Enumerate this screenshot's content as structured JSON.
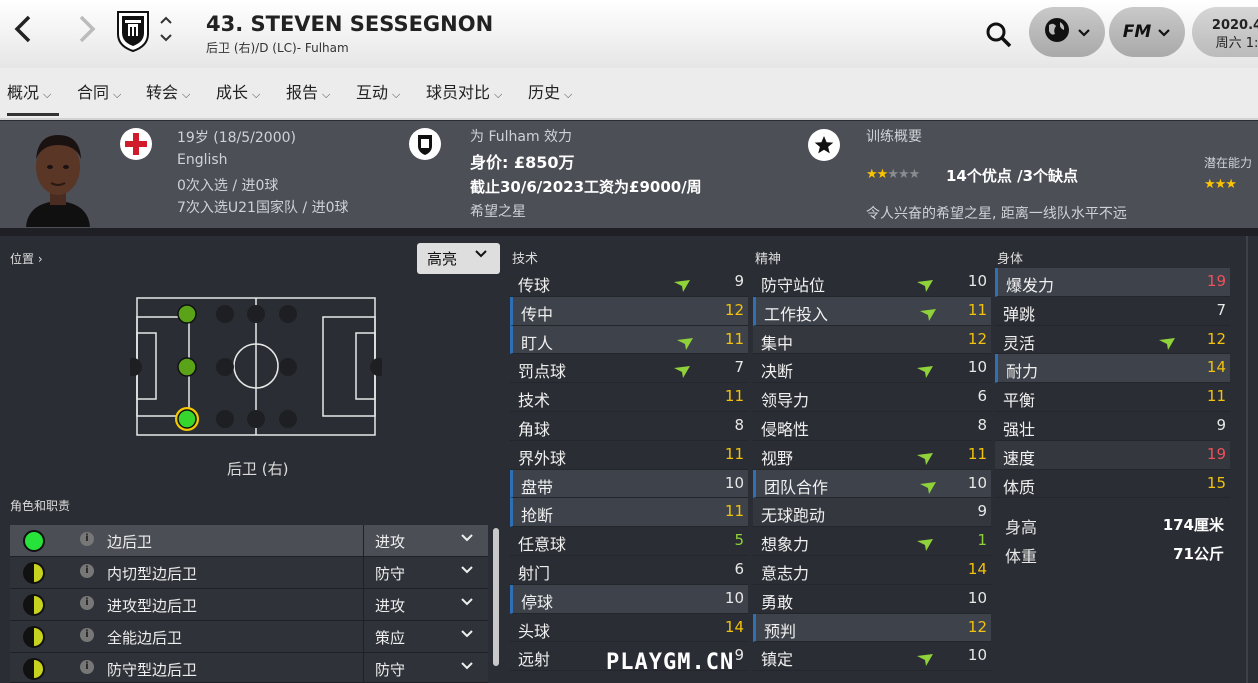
{
  "header": {
    "player_name": "43. STEVEN SESSEGNON",
    "player_sub": "后卫 (右)/D (LC)- Fulham",
    "date_line1": "2020.4",
    "date_line2": "周六 1:"
  },
  "tabs": [
    {
      "label": "概况"
    },
    {
      "label": "合同"
    },
    {
      "label": "转会"
    },
    {
      "label": "成长"
    },
    {
      "label": "报告"
    },
    {
      "label": "互动"
    },
    {
      "label": "球员对比"
    },
    {
      "label": "历史"
    }
  ],
  "info": {
    "age": "19岁 (18/5/2000)",
    "nationality": "English",
    "caps": "0次入选 / 进0球",
    "u21_caps": "7次入选U21国家队 / 进0球",
    "club_line": "为 Fulham 效力",
    "value": "身价: £850万",
    "contract": "截止30/6/2023工资为£9000/周",
    "status": "希望之星",
    "training_title": "训练概要",
    "traits": "14个优点 /3个缺点",
    "potential_label": "潜在能力",
    "scout_comment": "令人兴奋的希望之星, 距离一线队水平不远",
    "current_stars": 2,
    "potential_stars": 3
  },
  "position": {
    "label": "位置",
    "highlight_select": "高亮",
    "caption": "后卫 (右)"
  },
  "roles_label": "角色和职责",
  "roles": [
    {
      "name": "边后卫",
      "duty": "进攻",
      "rating": "full"
    },
    {
      "name": "内切型边后卫",
      "duty": "防守",
      "rating": "half"
    },
    {
      "name": "进攻型边后卫",
      "duty": "进攻",
      "rating": "half"
    },
    {
      "name": "全能边后卫",
      "duty": "策应",
      "rating": "half"
    },
    {
      "name": "防守型边后卫",
      "duty": "防守",
      "rating": "half"
    }
  ],
  "technical": {
    "header": "技术",
    "attrs": [
      {
        "name": "传球",
        "value": "9",
        "tone": "w",
        "arrow": true,
        "hl": ""
      },
      {
        "name": "传中",
        "value": "12",
        "tone": "y",
        "arrow": false,
        "hl": "hl"
      },
      {
        "name": "盯人",
        "value": "11",
        "tone": "y",
        "arrow": true,
        "hl": "hl"
      },
      {
        "name": "罚点球",
        "value": "7",
        "tone": "w",
        "arrow": true,
        "hl": ""
      },
      {
        "name": "技术",
        "value": "11",
        "tone": "y",
        "arrow": false,
        "hl": ""
      },
      {
        "name": "角球",
        "value": "8",
        "tone": "w",
        "arrow": false,
        "hl": ""
      },
      {
        "name": "界外球",
        "value": "11",
        "tone": "y",
        "arrow": false,
        "hl": ""
      },
      {
        "name": "盘带",
        "value": "10",
        "tone": "w",
        "arrow": false,
        "hl": "hl"
      },
      {
        "name": "抢断",
        "value": "11",
        "tone": "y",
        "arrow": false,
        "hl": "hl"
      },
      {
        "name": "任意球",
        "value": "5",
        "tone": "g",
        "arrow": false,
        "hl": ""
      },
      {
        "name": "射门",
        "value": "6",
        "tone": "w",
        "arrow": false,
        "hl": ""
      },
      {
        "name": "停球",
        "value": "10",
        "tone": "w",
        "arrow": false,
        "hl": "hl"
      },
      {
        "name": "头球",
        "value": "14",
        "tone": "y",
        "arrow": false,
        "hl": ""
      },
      {
        "name": "远射",
        "value": "9",
        "tone": "w",
        "arrow": false,
        "hl": ""
      }
    ]
  },
  "mental": {
    "header": "精神",
    "attrs": [
      {
        "name": "防守站位",
        "value": "10",
        "tone": "w",
        "arrow": true,
        "hl": ""
      },
      {
        "name": "工作投入",
        "value": "11",
        "tone": "y",
        "arrow": true,
        "hl": "hl"
      },
      {
        "name": "集中",
        "value": "12",
        "tone": "y",
        "arrow": false,
        "hl": "hl2"
      },
      {
        "name": "决断",
        "value": "10",
        "tone": "w",
        "arrow": true,
        "hl": ""
      },
      {
        "name": "领导力",
        "value": "6",
        "tone": "w",
        "arrow": false,
        "hl": ""
      },
      {
        "name": "侵略性",
        "value": "8",
        "tone": "w",
        "arrow": false,
        "hl": ""
      },
      {
        "name": "视野",
        "value": "11",
        "tone": "y",
        "arrow": true,
        "hl": ""
      },
      {
        "name": "团队合作",
        "value": "10",
        "tone": "w",
        "arrow": true,
        "hl": "hl"
      },
      {
        "name": "无球跑动",
        "value": "9",
        "tone": "w",
        "arrow": false,
        "hl": "hl2"
      },
      {
        "name": "想象力",
        "value": "1",
        "tone": "g",
        "arrow": true,
        "hl": ""
      },
      {
        "name": "意志力",
        "value": "14",
        "tone": "y",
        "arrow": false,
        "hl": ""
      },
      {
        "name": "勇敢",
        "value": "10",
        "tone": "w",
        "arrow": false,
        "hl": ""
      },
      {
        "name": "预判",
        "value": "12",
        "tone": "y",
        "arrow": false,
        "hl": "hl"
      },
      {
        "name": "镇定",
        "value": "10",
        "tone": "w",
        "arrow": true,
        "hl": ""
      }
    ]
  },
  "physical": {
    "header": "身体",
    "attrs": [
      {
        "name": "爆发力",
        "value": "19",
        "tone": "r",
        "arrow": false,
        "hl": "hl"
      },
      {
        "name": "弹跳",
        "value": "7",
        "tone": "w",
        "arrow": false,
        "hl": ""
      },
      {
        "name": "灵活",
        "value": "12",
        "tone": "y",
        "arrow": true,
        "hl": ""
      },
      {
        "name": "耐力",
        "value": "14",
        "tone": "y",
        "arrow": false,
        "hl": "hl"
      },
      {
        "name": "平衡",
        "value": "11",
        "tone": "y",
        "arrow": false,
        "hl": ""
      },
      {
        "name": "强壮",
        "value": "9",
        "tone": "w",
        "arrow": false,
        "hl": ""
      },
      {
        "name": "速度",
        "value": "19",
        "tone": "r",
        "arrow": false,
        "hl": "hl2"
      },
      {
        "name": "体质",
        "value": "15",
        "tone": "y",
        "arrow": false,
        "hl": ""
      }
    ],
    "height_label": "身高",
    "height_value": "174厘米",
    "weight_label": "体重",
    "weight_value": "71公斤"
  },
  "watermark": "PLAYGM.CN",
  "colors": {
    "arrow": "#8fd23a",
    "highlight_blue": "#2f6fb5",
    "star": "#fbc400"
  }
}
